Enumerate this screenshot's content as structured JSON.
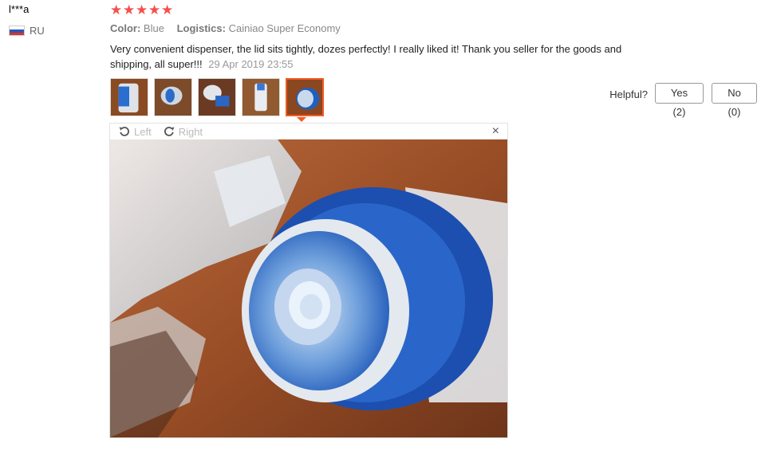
{
  "review": {
    "user_name": "l***a",
    "country": "RU",
    "rating_stars": 5,
    "color_key": "Color:",
    "color_value": "Blue",
    "logistics_key": "Logistics:",
    "logistics_value": "Cainiao Super Economy",
    "text": "Very convenient dispenser, the lid sits tightly, dozes perfectly! I really liked it! Thank you seller for the goods and shipping, all super!!!",
    "date": "29 Apr 2019 23:55"
  },
  "helpful": {
    "label": "Helpful?",
    "yes_label": "Yes (2)",
    "no_label": "No (0)"
  },
  "viewer": {
    "rotate_left_label": "Left",
    "rotate_right_label": "Right",
    "close_glyph": "×",
    "selected_thumb_index": 4
  },
  "colors": {
    "star": "#f44f4f",
    "active_border": "#f45b22"
  }
}
